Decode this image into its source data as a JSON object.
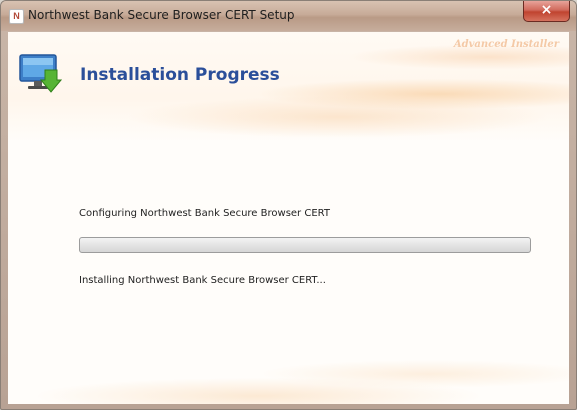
{
  "window": {
    "title": "Northwest Bank Secure Browser CERT Setup",
    "close_glyph": "×"
  },
  "header": {
    "brand": "Advanced Installer",
    "title": "Installation Progress",
    "icon": "monitor-download-icon"
  },
  "main": {
    "status_text": "Configuring Northwest Bank Secure Browser CERT",
    "progress_fraction": 0.0,
    "action_text": "Installing Northwest Bank Secure Browser CERT..."
  },
  "colors": {
    "title_blue": "#2b4f9a",
    "close_red": "#c0432f",
    "progress_track": "#e4e4e4"
  }
}
